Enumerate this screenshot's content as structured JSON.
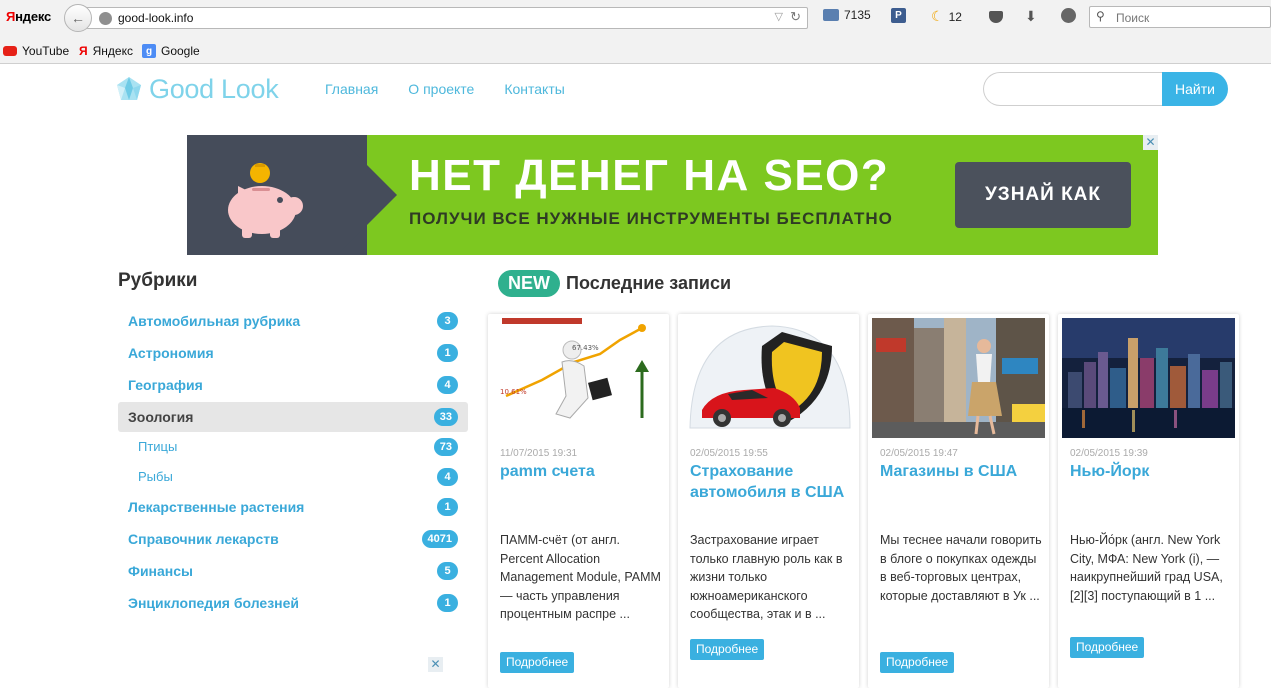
{
  "browser": {
    "brand": {
      "part1": "Я",
      "part2": "ндекс"
    },
    "url": "good-look.info",
    "mail_count": "7135",
    "park_label": "P",
    "weather_count": "12",
    "search_placeholder": "Поиск",
    "bookmarks": [
      {
        "label": "YouTube"
      },
      {
        "label": "Яндекс"
      },
      {
        "label": "Google"
      }
    ]
  },
  "site": {
    "logo_text": "Good Look",
    "nav": [
      {
        "label": "Главная"
      },
      {
        "label": "О проекте"
      },
      {
        "label": "Контакты"
      }
    ],
    "search_button": "Найти"
  },
  "banner": {
    "headline": "НЕТ ДЕНЕГ НА SEO?",
    "subline": "ПОЛУЧИ ВСЕ НУЖНЫЕ ИНСТРУМЕНТЫ БЕСПЛАТНО",
    "cta": "УЗНАЙ КАК"
  },
  "sidebar": {
    "title": "Рубрики",
    "categories": [
      {
        "label": "Автомобильная рубрика",
        "count": "3"
      },
      {
        "label": "Астрономия",
        "count": "1"
      },
      {
        "label": "География",
        "count": "4"
      },
      {
        "label": "Зоология",
        "count": "33"
      },
      {
        "label": "Птицы",
        "count": "73"
      },
      {
        "label": "Рыбы",
        "count": "4"
      },
      {
        "label": "Лекарственные растения",
        "count": "1"
      },
      {
        "label": "Справочник лекарств",
        "count": "4071"
      },
      {
        "label": "Финансы",
        "count": "5"
      },
      {
        "label": "Энциклопедия болезней",
        "count": "1"
      }
    ]
  },
  "posts": {
    "badge": "NEW",
    "title": "Последние записи",
    "more_label": "Подробнее",
    "items": [
      {
        "date": "11/07/2015 19:31",
        "title": "pamm счета",
        "excerpt": "ПАММ-счёт (от англ. Percent Allocation Management Module, PAMM — часть управления процентным распре ..."
      },
      {
        "date": "02/05/2015 19:55",
        "title": "Страхование автомобиля в США",
        "excerpt": "Застрахование играет только главную роль как в жизни только южноамериканского сообщества, этак и в ..."
      },
      {
        "date": "02/05/2015 19:47",
        "title": "Магазины в США",
        "excerpt": "Мы теснее начали говорить в блоге о покупках одежды в веб-торговых центрах, которые доставляют в Ук ..."
      },
      {
        "date": "02/05/2015 19:39",
        "title": "Нью-Йорк",
        "excerpt": "Нью-Йо́рк (англ. New York City, МФА: New York (i), — наикрупнейший град USA,[2][3] поступающий в 1 ..."
      }
    ]
  },
  "ad_close_label": "✕"
}
